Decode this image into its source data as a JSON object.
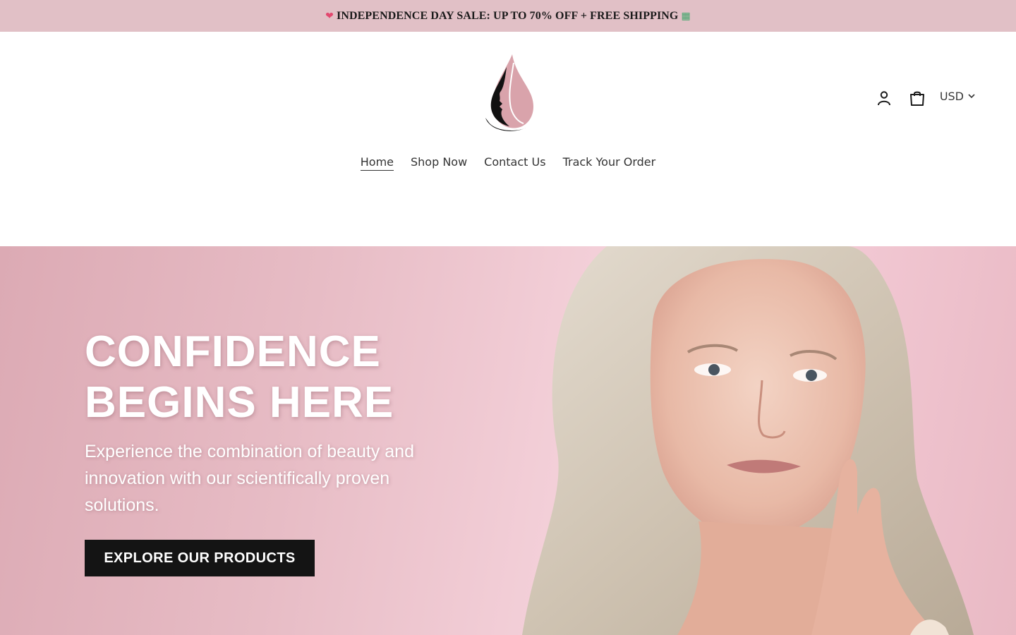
{
  "announcement": {
    "text": "INDEPENDENCE DAY SALE: UP TO 70% OFF + FREE SHIPPING",
    "leading_icon": "heart-gift-icon",
    "trailing_icon": "shopping-bags-icon"
  },
  "header": {
    "logo_icon": "woman-profile-droplet-logo",
    "account_icon": "user-icon",
    "cart_icon": "shopping-bag-icon",
    "currency": "USD"
  },
  "nav": {
    "items": [
      {
        "label": "Home",
        "active": true
      },
      {
        "label": "Shop Now",
        "active": false
      },
      {
        "label": "Contact Us",
        "active": false
      },
      {
        "label": "Track Your Order",
        "active": false
      }
    ]
  },
  "hero": {
    "title_line1": "CONFIDENCE",
    "title_line2": "BEGINS HERE",
    "subtitle": "Experience the combination of beauty and innovation with our scientifically proven solutions.",
    "cta_label": "EXPLORE OUR PRODUCTS"
  },
  "colors": {
    "announcement_bg": "#e1c0c6",
    "brand_pink": "#d9a3ab",
    "hero_bg": "#ebc0ca",
    "cta_bg": "#141414"
  }
}
